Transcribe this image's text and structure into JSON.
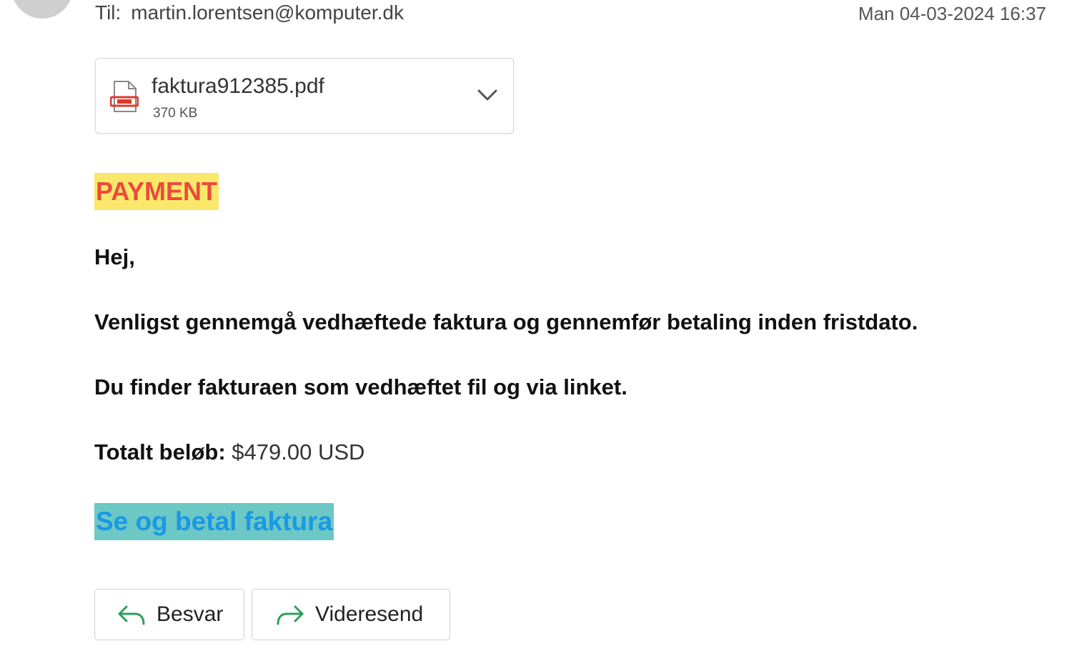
{
  "header": {
    "to_label": "Til:",
    "to_address": "martin.lorentsen@komputer.dk",
    "timestamp": "Man 04-03-2024 16:37"
  },
  "attachment": {
    "file_name": "faktura912385.pdf",
    "file_size": "370 KB",
    "icon": "pdf-file-icon"
  },
  "body": {
    "heading": "PAYMENT",
    "greeting": "Hej,",
    "paragraph1": "Venligst gennemgå vedhæftede faktura og gennemfør betaling inden fristdato.",
    "paragraph2": "Du finder fakturaen som vedhæftet fil og via linket.",
    "total_label": "Totalt beløb:",
    "total_amount": "$479.00 USD",
    "link_text": "Se og betal faktura"
  },
  "actions": {
    "reply_label": "Besvar",
    "forward_label": "Videresend"
  },
  "colors": {
    "heading_bg": "#fbe86a",
    "heading_text": "#ea4b3c",
    "link_bg": "#6cc8c4",
    "link_text": "#1a98e6",
    "action_icon": "#2e9e5b"
  }
}
